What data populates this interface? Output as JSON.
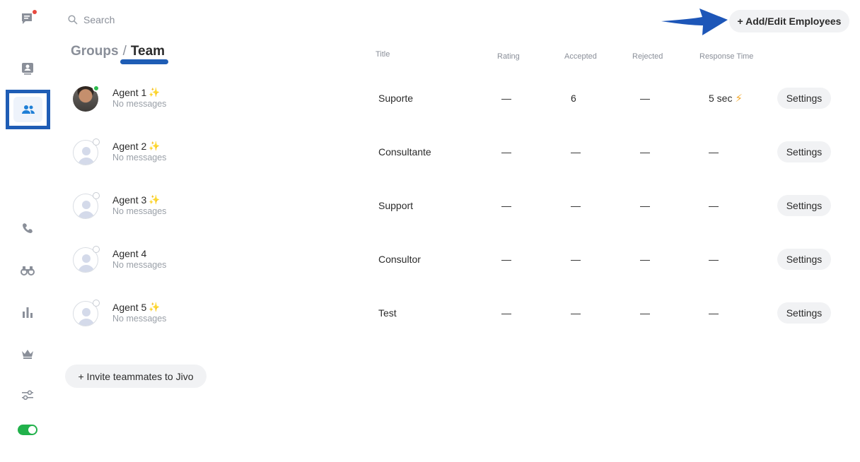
{
  "search": {
    "placeholder": "Search"
  },
  "header": {
    "add_button": "+ Add/Edit Employees"
  },
  "breadcrumb": {
    "groups": "Groups",
    "separator": "/",
    "team": "Team"
  },
  "columns": {
    "title": "Title",
    "rating": "Rating",
    "accepted": "Accepted",
    "rejected": "Rejected",
    "response_time": "Response Time"
  },
  "agents": [
    {
      "name": "Agent 1",
      "status": "No messages",
      "title": "Suporte",
      "rating": "—",
      "accepted": "6",
      "rejected": "—",
      "response_time": "5 sec",
      "settings": "Settings",
      "online": true,
      "highlight": true
    },
    {
      "name": "Agent 2",
      "status": "No messages",
      "title": "Consultante",
      "rating": "—",
      "accepted": "—",
      "rejected": "—",
      "response_time": "—",
      "settings": "Settings",
      "online": false,
      "highlight": false
    },
    {
      "name": "Agent 3",
      "status": "No messages",
      "title": "Support",
      "rating": "—",
      "accepted": "—",
      "rejected": "—",
      "response_time": "—",
      "settings": "Settings",
      "online": false,
      "highlight": false
    },
    {
      "name": "Agent 4",
      "status": "No messages",
      "title": "Consultor",
      "rating": "—",
      "accepted": "—",
      "rejected": "—",
      "response_time": "—",
      "settings": "Settings",
      "online": false,
      "highlight": false
    },
    {
      "name": "Agent 5",
      "status": "No messages",
      "title": "Test",
      "rating": "—",
      "accepted": "—",
      "rejected": "—",
      "response_time": "—",
      "settings": "Settings",
      "online": false,
      "highlight": false
    }
  ],
  "footer": {
    "invite_button": "+ Invite teammates to Jivo"
  },
  "sidebar": {
    "icons": [
      "chats-icon",
      "visitors-icon",
      "team-icon",
      "phone-icon",
      "binoculars-icon",
      "reports-icon",
      "crown-icon",
      "settings-sliders-icon",
      "status-toggle"
    ]
  },
  "colors": {
    "accent": "#1f5db5",
    "online": "#2ebc4f",
    "toggle": "#21b14b",
    "notification": "#e8493f",
    "lightning": "#f3a92b"
  }
}
